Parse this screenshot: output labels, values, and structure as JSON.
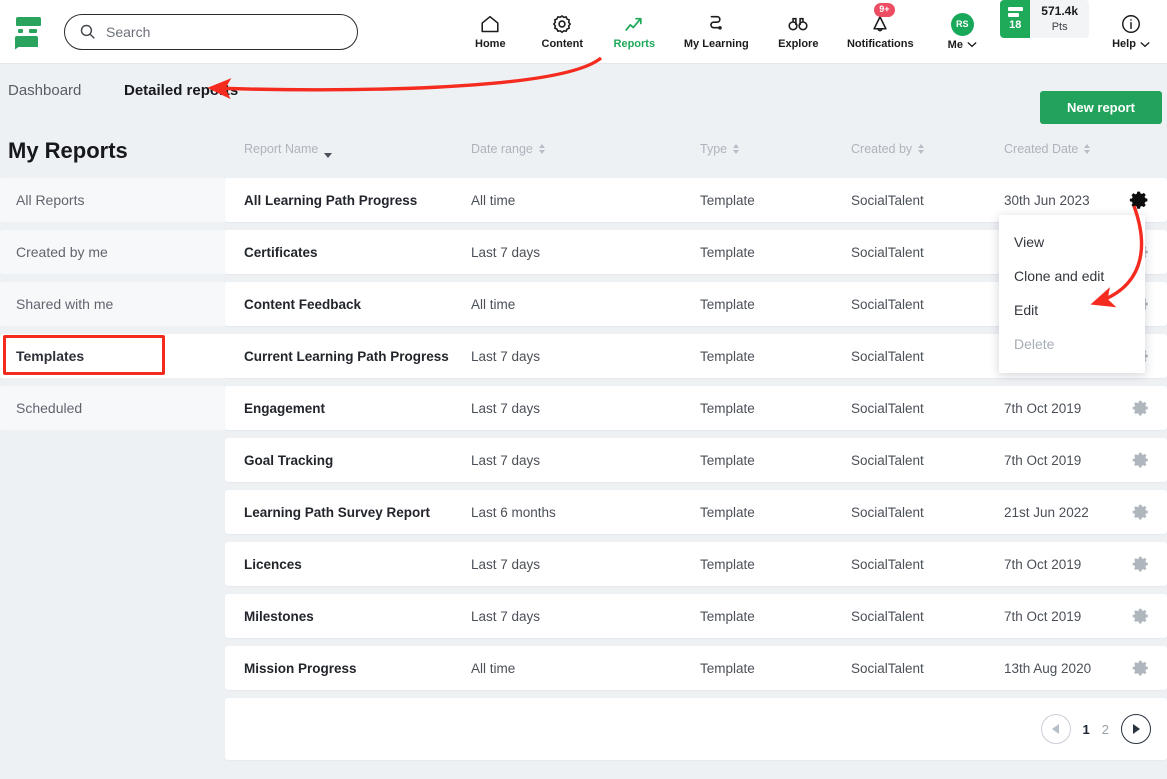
{
  "header": {
    "logo_name": "socialtalent-logo",
    "search": {
      "placeholder": "Search",
      "value": ""
    },
    "nav": [
      {
        "id": "home",
        "label": "Home",
        "icon": "home-icon",
        "active": false
      },
      {
        "id": "content",
        "label": "Content",
        "icon": "gear-icon",
        "active": false
      },
      {
        "id": "reports",
        "label": "Reports",
        "icon": "trend-arrow-icon",
        "active": true
      },
      {
        "id": "my-learning",
        "label": "My Learning",
        "icon": "path-icon",
        "active": false
      },
      {
        "id": "explore",
        "label": "Explore",
        "icon": "binoculars-icon",
        "active": false
      },
      {
        "id": "notifications",
        "label": "Notifications",
        "icon": "bell-icon",
        "active": false,
        "badge": "9+"
      }
    ],
    "me": {
      "label": "Me",
      "initials": "RS",
      "chevron": "chevron-down-icon"
    },
    "points": {
      "level": "18",
      "value": "571.4k",
      "unit": "Pts"
    },
    "help": {
      "label": "Help",
      "icon": "info-icon",
      "chevron": "chevron-down-icon"
    }
  },
  "subnav": {
    "dashboard_label": "Dashboard",
    "detailed_label": "Detailed reports",
    "new_report_label": "New report"
  },
  "page_title": "My Reports",
  "sidebar": {
    "items": [
      {
        "label": "All Reports",
        "selected": false
      },
      {
        "label": "Created by me",
        "selected": false
      },
      {
        "label": "Shared with me",
        "selected": false
      },
      {
        "label": "Templates",
        "selected": true
      },
      {
        "label": "Scheduled",
        "selected": false
      }
    ]
  },
  "table": {
    "columns": [
      {
        "label": "Report Name",
        "sort": "desc"
      },
      {
        "label": "Date range",
        "sort": "both"
      },
      {
        "label": "Type",
        "sort": "both"
      },
      {
        "label": "Created by",
        "sort": "both"
      },
      {
        "label": "Created Date",
        "sort": "both"
      }
    ],
    "rows": [
      {
        "name": "All Learning Path Progress",
        "range": "All time",
        "type": "Template",
        "by": "SocialTalent",
        "date": "30th Jun 2023",
        "menu_open": true
      },
      {
        "name": "Certificates",
        "range": "Last 7 days",
        "type": "Template",
        "by": "SocialTalent",
        "date": "",
        "menu_open": false
      },
      {
        "name": "Content Feedback",
        "range": "All time",
        "type": "Template",
        "by": "SocialTalent",
        "date": "",
        "menu_open": false
      },
      {
        "name": "Current Learning Path Progress",
        "range": "Last 7 days",
        "type": "Template",
        "by": "SocialTalent",
        "date": "",
        "menu_open": false
      },
      {
        "name": "Engagement",
        "range": "Last 7 days",
        "type": "Template",
        "by": "SocialTalent",
        "date": "7th Oct 2019",
        "menu_open": false
      },
      {
        "name": "Goal Tracking",
        "range": "Last 7 days",
        "type": "Template",
        "by": "SocialTalent",
        "date": "7th Oct 2019",
        "menu_open": false
      },
      {
        "name": "Learning Path Survey Report",
        "range": "Last 6 months",
        "type": "Template",
        "by": "SocialTalent",
        "date": "21st Jun 2022",
        "menu_open": false
      },
      {
        "name": "Licences",
        "range": "Last 7 days",
        "type": "Template",
        "by": "SocialTalent",
        "date": "7th Oct 2019",
        "menu_open": false
      },
      {
        "name": "Milestones",
        "range": "Last 7 days",
        "type": "Template",
        "by": "SocialTalent",
        "date": "7th Oct 2019",
        "menu_open": false
      },
      {
        "name": "Mission Progress",
        "range": "All time",
        "type": "Template",
        "by": "SocialTalent",
        "date": "13th Aug 2020",
        "menu_open": false
      }
    ]
  },
  "row_menu": {
    "items": [
      {
        "label": "View",
        "disabled": false
      },
      {
        "label": "Clone and edit",
        "disabled": false
      },
      {
        "label": "Edit",
        "disabled": false
      },
      {
        "label": "Delete",
        "disabled": true
      }
    ]
  },
  "pagination": {
    "prev_icon": "triangle-left-icon",
    "next_icon": "triangle-right-icon",
    "pages": [
      {
        "label": "1",
        "current": true
      },
      {
        "label": "2",
        "current": false
      }
    ]
  },
  "annotations": {
    "highlight_color": "#f42b1e",
    "boxes": [
      "reports-nav-item",
      "templates-sidebar-item"
    ],
    "arrows": [
      "arrow-to-detailed-reports",
      "arrow-to-edit-menu-item"
    ]
  }
}
